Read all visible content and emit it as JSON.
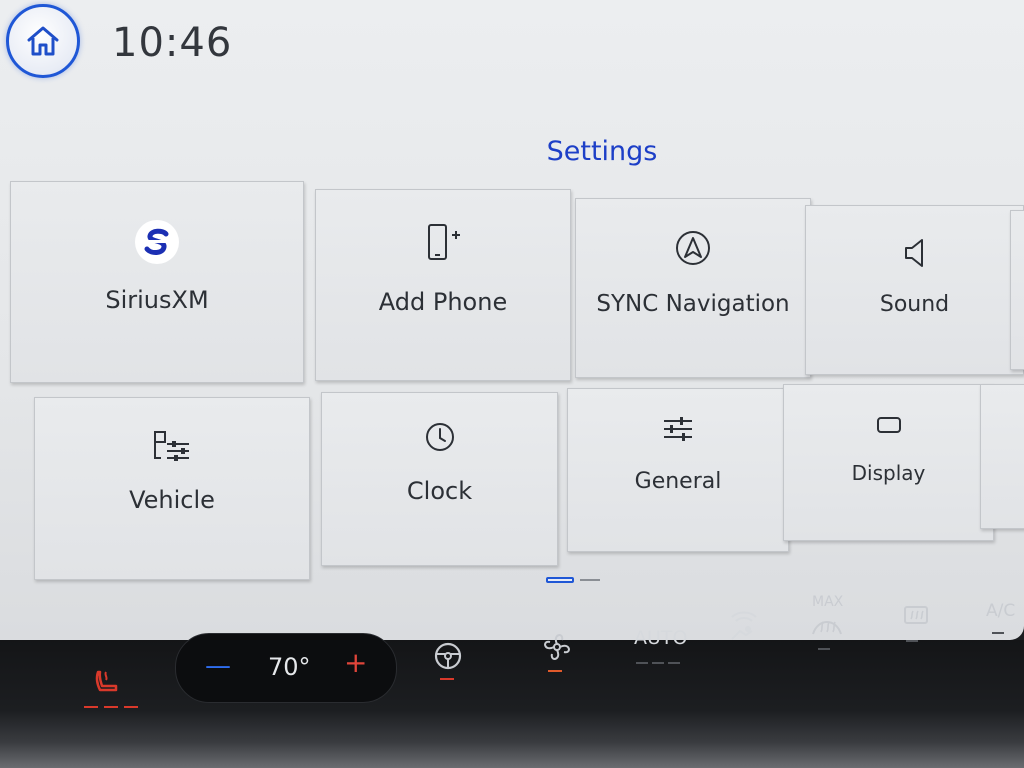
{
  "header": {
    "time": "10:46",
    "home_icon": "home-icon"
  },
  "page": {
    "title": "Settings"
  },
  "tiles": [
    {
      "label": "SiriusXM",
      "icon": "siriusxm-icon"
    },
    {
      "label": "Add Phone",
      "icon": "add-phone-icon"
    },
    {
      "label": "SYNC Navigation",
      "icon": "navigation-icon"
    },
    {
      "label": "Sound",
      "icon": "speaker-icon"
    },
    {
      "label": "Vehicle",
      "icon": "vehicle-settings-icon"
    },
    {
      "label": "Clock",
      "icon": "clock-icon"
    },
    {
      "label": "General",
      "icon": "sliders-icon"
    },
    {
      "label": "Display",
      "icon": "display-icon"
    }
  ],
  "pagination": {
    "total_pages": 2,
    "current_page": 1
  },
  "climate": {
    "temp_minus": "—",
    "temperature": "70°",
    "temp_plus": "+",
    "auto_label": "AUTO",
    "max_label": "MAX",
    "ac_label": "A/C"
  },
  "colors": {
    "accent": "#1d3fc7",
    "active_red": "#d9392b",
    "text": "#2c3036"
  }
}
